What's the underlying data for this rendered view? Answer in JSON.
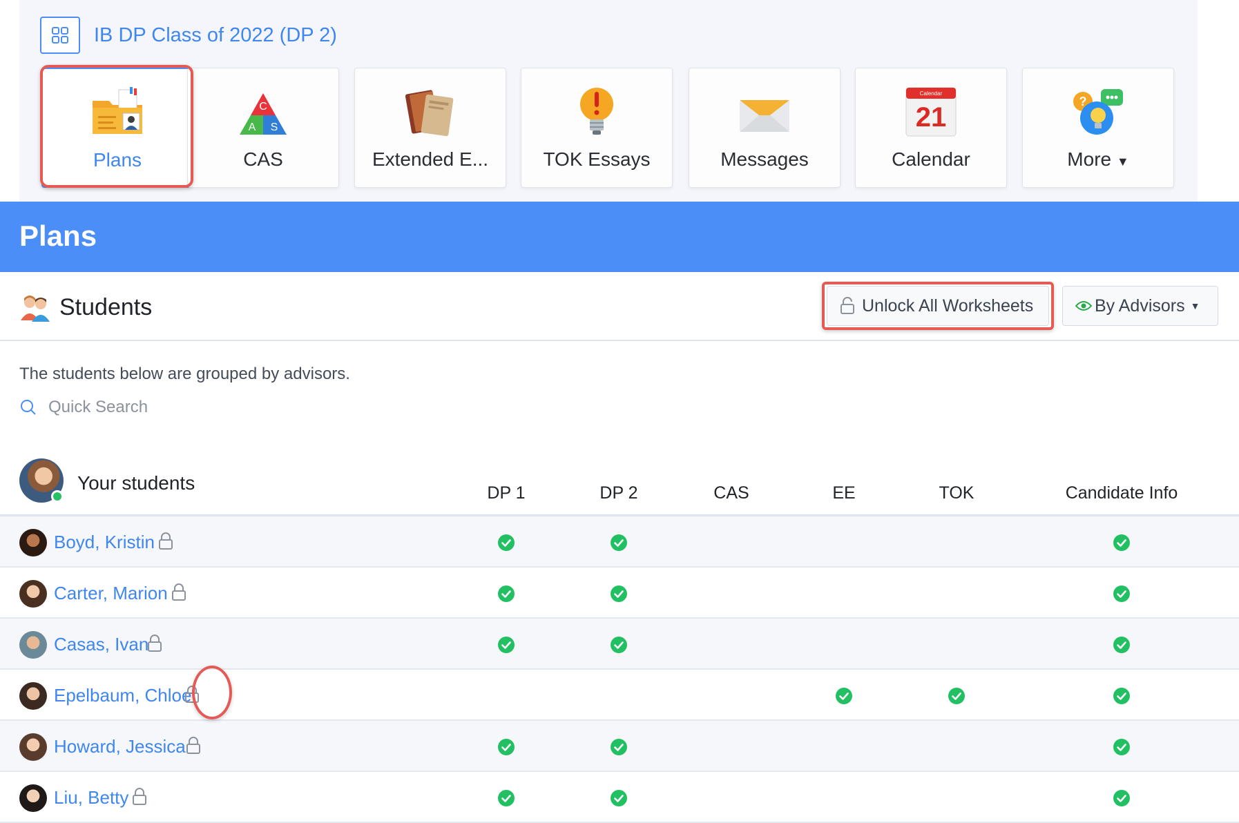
{
  "header": {
    "class_title": "IB DP Class of 2022 (DP 2)",
    "grid_icon": "grid-icon"
  },
  "tiles": [
    {
      "label": "Plans",
      "icon": "plans-folder-icon",
      "active": true
    },
    {
      "label": "CAS",
      "icon": "cas-triangle-icon",
      "active": false
    },
    {
      "label": "Extended E...",
      "icon": "extended-essay-books-icon",
      "active": false
    },
    {
      "label": "TOK Essays",
      "icon": "tok-lightbulb-icon",
      "active": false
    },
    {
      "label": "Messages",
      "icon": "messages-envelope-icon",
      "active": false
    },
    {
      "label": "Calendar",
      "icon": "calendar-icon",
      "active": false
    },
    {
      "label": "More",
      "icon": "more-chat-bubbles-icon",
      "active": false
    }
  ],
  "calendar_icon": {
    "month": "Calendar",
    "day": "21"
  },
  "cas_icon_letters": {
    "top": "C",
    "left": "A",
    "right": "S"
  },
  "banner": {
    "title": "Plans"
  },
  "students_section": {
    "title": "Students",
    "unlock_button": "Unlock All Worksheets",
    "view_button": "By Advisors",
    "hint": "The students below are grouped by advisors.",
    "search_placeholder": "Quick Search"
  },
  "table": {
    "group_title": "Your students",
    "columns": [
      "DP 1",
      "DP 2",
      "CAS",
      "EE",
      "TOK",
      "Candidate Info"
    ],
    "rows": [
      {
        "name": "Boyd, Kristin",
        "checks": [
          true,
          true,
          false,
          false,
          false,
          true
        ]
      },
      {
        "name": "Carter, Marion",
        "checks": [
          true,
          true,
          false,
          false,
          false,
          true
        ]
      },
      {
        "name": "Casas, Ivan",
        "checks": [
          true,
          true,
          false,
          false,
          false,
          true
        ]
      },
      {
        "name": "Epelbaum, Chloe",
        "checks": [
          false,
          false,
          false,
          true,
          true,
          true
        ]
      },
      {
        "name": "Howard, Jessica",
        "checks": [
          true,
          true,
          false,
          false,
          false,
          true
        ]
      },
      {
        "name": "Liu, Betty",
        "checks": [
          true,
          true,
          false,
          false,
          false,
          true
        ]
      }
    ]
  },
  "colors": {
    "accent": "#3f86ef",
    "banner": "#4b8ef8",
    "check": "#22c063",
    "highlight": "#e45b56"
  }
}
